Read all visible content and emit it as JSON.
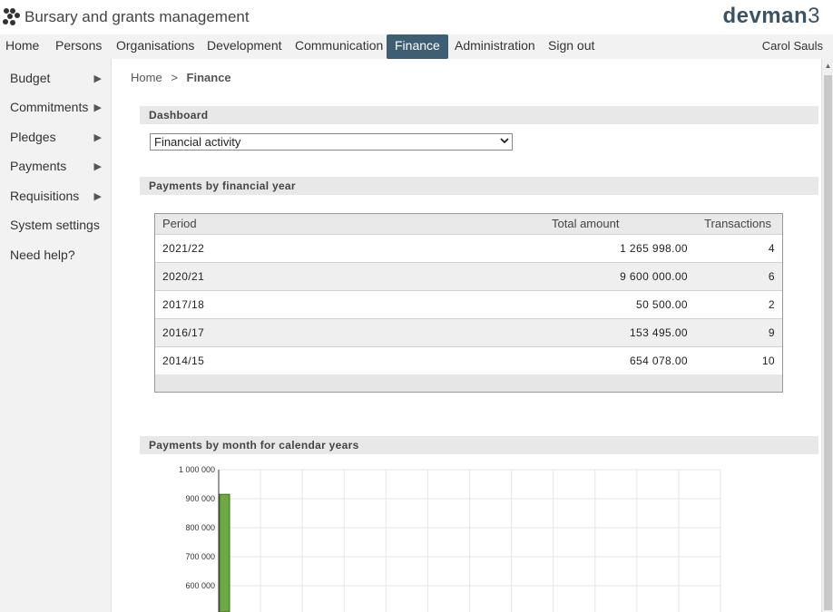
{
  "app": {
    "title": "Bursary and grants management",
    "brand_text": "devman",
    "brand_num": "3"
  },
  "nav": {
    "items": [
      "Home",
      "Persons",
      "Organisations",
      "Development",
      "Communication",
      "Finance",
      "Administration",
      "Sign out"
    ],
    "active": "Finance",
    "user": "Carol Sauls"
  },
  "sidebar": {
    "items": [
      {
        "label": "Budget",
        "has_submenu": true
      },
      {
        "label": "Commitments",
        "has_submenu": true
      },
      {
        "label": "Pledges",
        "has_submenu": true
      },
      {
        "label": "Payments",
        "has_submenu": true
      },
      {
        "label": "Requisitions",
        "has_submenu": true
      },
      {
        "label": "System settings",
        "has_submenu": false
      },
      {
        "label": "Need help?",
        "has_submenu": false
      }
    ],
    "submenu_icon": "triangle-right-icon"
  },
  "breadcrumb": {
    "home": "Home",
    "separator": ">",
    "current": "Finance"
  },
  "dashboard": {
    "header": "Dashboard",
    "selected": "Financial activity"
  },
  "payments_by_year": {
    "header": "Payments by financial year",
    "columns": [
      "Period",
      "Total amount",
      "Transactions"
    ],
    "rows": [
      {
        "period": "2021/22",
        "amount": "1 265 998.00",
        "count": "4"
      },
      {
        "period": "2020/21",
        "amount": "9 600 000.00",
        "count": "6"
      },
      {
        "period": "2017/18",
        "amount": "50 500.00",
        "count": "2"
      },
      {
        "period": "2016/17",
        "amount": "153 495.00",
        "count": "9"
      },
      {
        "period": "2014/15",
        "amount": "654 078.00",
        "count": "10"
      }
    ]
  },
  "payments_by_month": {
    "header": "Payments by month for calendar years"
  },
  "chart_data": {
    "type": "bar",
    "title": "",
    "xlabel": "",
    "ylabel": "",
    "y_tick_labels": [
      "1 000 000",
      "900 000",
      "800 000",
      "700 000",
      "600 000"
    ],
    "y_ticks": [
      1000000,
      900000,
      800000,
      700000,
      600000
    ],
    "ylim_visible": [
      560000,
      1000000
    ],
    "x_slots": 12,
    "grid": true,
    "series": [
      {
        "values": [
          915000
        ],
        "color": "#6ea843"
      }
    ]
  },
  "colors": {
    "nav_active": "#3e5f73",
    "brand": "#3b5366",
    "bar": "#6ea843"
  }
}
